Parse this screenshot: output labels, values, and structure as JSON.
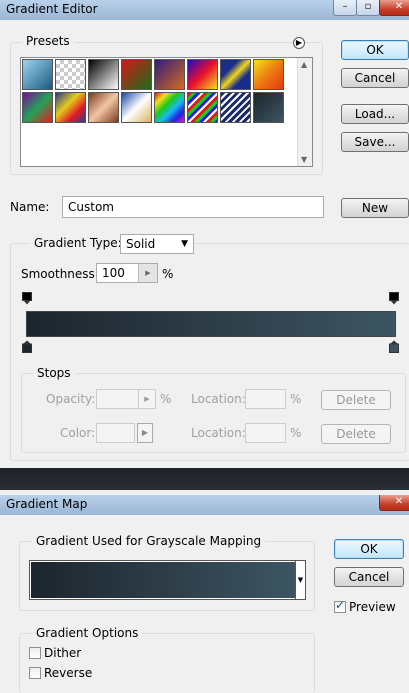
{
  "editor": {
    "title": "Gradient Editor",
    "presets_label": "Presets",
    "ok": "OK",
    "cancel": "Cancel",
    "load": "Load...",
    "save": "Save...",
    "name_label": "Name:",
    "name_value": "Custom",
    "new": "New",
    "gradient_type_label": "Gradient Type:",
    "gradient_type_value": "Solid",
    "smoothness_label": "Smoothness:",
    "smoothness_value": "100",
    "percent": "%",
    "stops_label": "Stops",
    "opacity_label": "Opacity:",
    "location_label": "Location:",
    "color_label": "Color:",
    "delete": "Delete"
  },
  "map": {
    "title": "Gradient Map",
    "group_label": "Gradient Used for Grayscale Mapping",
    "ok": "OK",
    "cancel": "Cancel",
    "preview_label": "Preview",
    "preview_checked": true,
    "options_label": "Gradient Options",
    "dither_label": "Dither",
    "reverse_label": "Reverse"
  },
  "colors": {
    "gradient_start": "#1d252d",
    "gradient_end": "#3d5563"
  }
}
